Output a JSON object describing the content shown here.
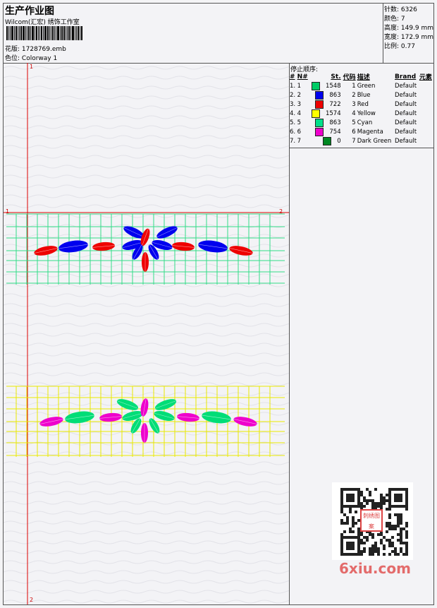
{
  "header": {
    "title": "生产作业图",
    "company": "Wilcom(汇宏) 绣饰工作室",
    "design_label": "花版:",
    "design_file": "1728769.emb",
    "colorway_label": "色位:",
    "colorway": "Colorway 1"
  },
  "stats": {
    "stitches": "针数: 6326",
    "colors": "颜色: 7",
    "height": "高度: 149.9 mm",
    "width": "宽度: 172.9 mm",
    "scale": "比例: 0.77"
  },
  "stop_sequence": {
    "title": "停止顺序:",
    "columns": [
      "#",
      "N#",
      "St.",
      "代码",
      "描述",
      "Brand",
      "元素"
    ],
    "rows": [
      {
        "idx": "1.",
        "n": "1",
        "color": "#00cc66",
        "st": "1548",
        "code": "1",
        "desc": "Green",
        "brand": "Default"
      },
      {
        "idx": "2.",
        "n": "2",
        "color": "#0000ee",
        "st": "863",
        "code": "2",
        "desc": "Blue",
        "brand": "Default"
      },
      {
        "idx": "3.",
        "n": "3",
        "color": "#ee0000",
        "st": "722",
        "code": "3",
        "desc": "Red",
        "brand": "Default"
      },
      {
        "idx": "4.",
        "n": "4",
        "color": "#ffff00",
        "st": "1574",
        "code": "4",
        "desc": "Yellow",
        "brand": "Default"
      },
      {
        "idx": "5.",
        "n": "5",
        "color": "#00e08a",
        "st": "863",
        "code": "5",
        "desc": "Cyan",
        "brand": "Default"
      },
      {
        "idx": "6.",
        "n": "6",
        "color": "#ee00cc",
        "st": "754",
        "code": "6",
        "desc": "Magenta",
        "brand": "Default"
      },
      {
        "idx": "7.",
        "n": "7",
        "color": "#008822",
        "st": "0",
        "code": "7",
        "desc": "Dark Green",
        "brand": "Default"
      }
    ]
  },
  "markers": {
    "top": "1",
    "left": "1",
    "right": "2",
    "bottom": "2"
  },
  "watermark": "6xiu.com",
  "qr_stamp": "刺绣图案"
}
